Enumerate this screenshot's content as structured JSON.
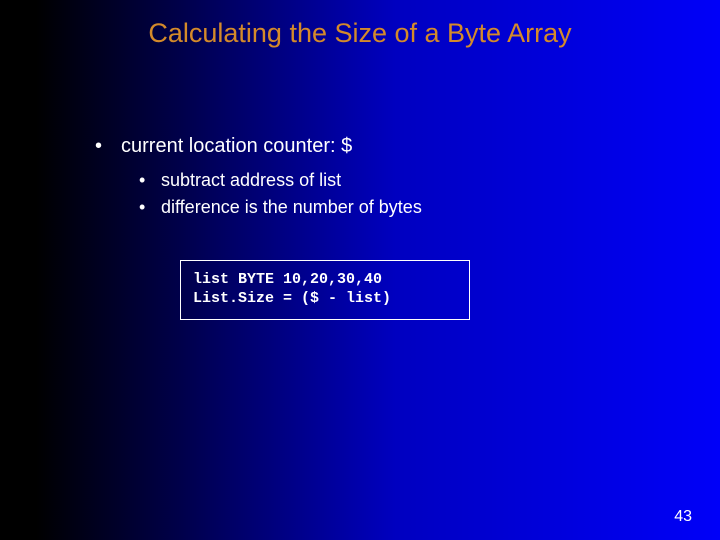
{
  "slide": {
    "title": "Calculating the Size of a Byte Array",
    "bullets": {
      "main": "current location counter: $",
      "sub1": "subtract address of list",
      "sub2": "difference is the number of bytes"
    },
    "code": {
      "line1": "list BYTE 10,20,30,40",
      "line2": "List.Size = ($ - list)"
    },
    "page_number": "43"
  }
}
